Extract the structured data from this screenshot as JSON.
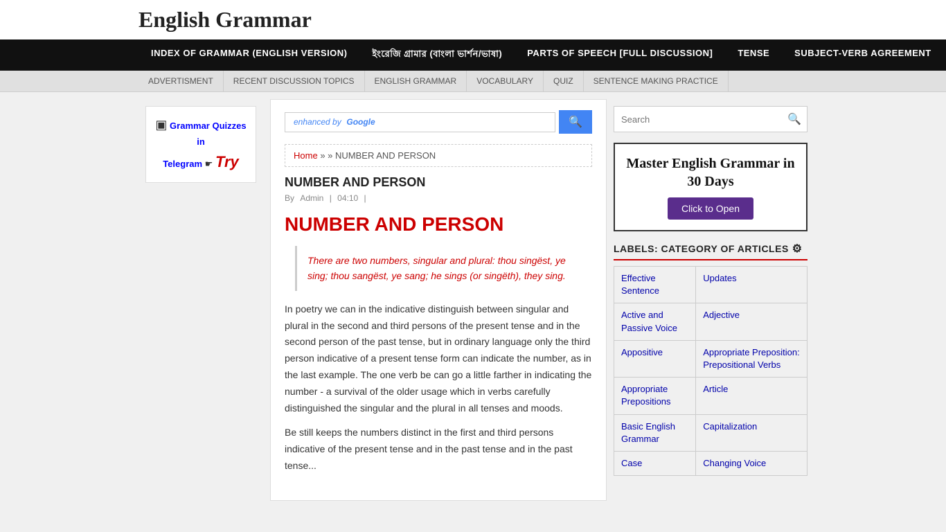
{
  "site": {
    "title": "English Grammar"
  },
  "nav": {
    "items": [
      {
        "id": "index",
        "label": "INDEX OF GRAMMAR (ENGLISH VERSION)",
        "active": false
      },
      {
        "id": "bangla",
        "label": "ইংরেজি গ্রামার (বাংলা ভার্শন/ভাষা)",
        "active": false
      },
      {
        "id": "parts",
        "label": "PARTS OF SPEECH [FULL DISCUSSION]",
        "active": false
      },
      {
        "id": "tense",
        "label": "TENSE",
        "active": false
      },
      {
        "id": "subject-verb",
        "label": "SUBJECT-VERB AGREEMENT",
        "active": false
      }
    ]
  },
  "secondary_nav": {
    "items": [
      {
        "label": "ADVERTISMENT"
      },
      {
        "label": "RECENT DISCUSSION TOPICS"
      },
      {
        "label": "ENGLISH GRAMMAR"
      },
      {
        "label": "VOCABULARY"
      },
      {
        "label": "QUIZ"
      },
      {
        "label": "SENTENCE MAKING PRACTICE"
      }
    ]
  },
  "sidebar_left": {
    "telegram_label": "Grammar Quizzes in",
    "telegram_word": "Telegram",
    "arrow": "☛",
    "try_label": "Try"
  },
  "search_bar": {
    "placeholder": "enhanced by Google",
    "button_icon": "🔍"
  },
  "breadcrumb": {
    "home": "Home",
    "separator": "» »",
    "current": "NUMBER AND PERSON"
  },
  "article": {
    "title": "NUMBER AND PERSON",
    "author": "Admin",
    "time": "04:10",
    "heading": "NUMBER AND PERSON",
    "quote": "There are two numbers, singular and plural: thou singëst, ye sing; thou sangëst, ye sang; he sings (or singëth), they sing.",
    "body1": "In poetry we can in the indicative distinguish between singular and plural in the second and third persons of the present tense and in the second person of the past tense, but in ordinary language only the third person indicative of a present tense form can indicate the number, as in the last example. The one verb be can go a little farther in indicating the number - a survival of the older usage which in verbs carefully distinguished the singular and the plural in all tenses and moods.",
    "body2": "Be still keeps the numbers distinct in the first and third persons indicative of the present tense and in the past tense and in the past tense..."
  },
  "right_sidebar": {
    "search_placeholder": "Search",
    "master_grammar": {
      "title": "Master English Grammar in 30 Days",
      "button": "Click to Open"
    },
    "labels_header": "LABELS: CATEGORY OF ARTICLES",
    "gear_icon": "⚙",
    "categories": [
      {
        "left": "Effective Sentence ",
        "right": "Updates "
      },
      {
        "left": "Active and Passive Voice",
        "right": "Adjective"
      },
      {
        "left": "Appositive",
        "right": "Appropriate Preposition: Prepositional Verbs"
      },
      {
        "left": "Appropriate Prepositions",
        "right": "Article"
      },
      {
        "left": "Basic English Grammar",
        "right": "Capitalization"
      },
      {
        "left": "Case",
        "right": "Changing Voice"
      }
    ]
  }
}
